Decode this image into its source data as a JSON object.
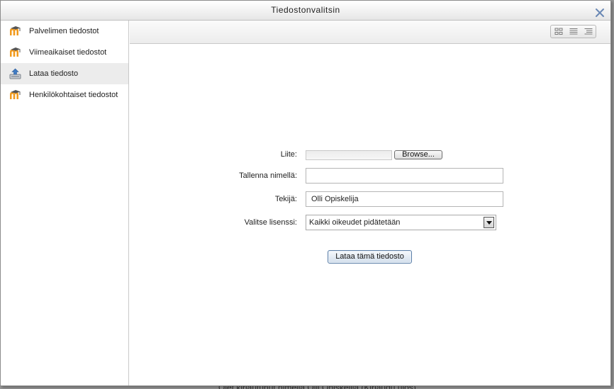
{
  "backdrop": {
    "text": "Olet kirjautunut nimellä Olli Opiskelija (Kirjaudu ulos)"
  },
  "dialog": {
    "title": "Tiedostonvalitsin",
    "close_icon": "close-icon"
  },
  "sidebar": {
    "items": [
      {
        "label": "Palvelimen tiedostot",
        "icon": "moodle-icon",
        "active": false
      },
      {
        "label": "Viimeaikaiset tiedostot",
        "icon": "moodle-icon",
        "active": false
      },
      {
        "label": "Lataa tiedosto",
        "icon": "upload-icon",
        "active": true
      },
      {
        "label": "Henkilökohtaiset tiedostot",
        "icon": "moodle-icon",
        "active": false
      }
    ]
  },
  "toolbar": {
    "view_buttons": [
      "icons-view-icon",
      "list-view-icon",
      "tree-view-icon"
    ]
  },
  "form": {
    "attachment_label": "Liite:",
    "browse_label": "Browse...",
    "save_as_label": "Tallenna nimellä:",
    "save_as_value": "",
    "author_label": "Tekijä:",
    "author_value": "Olli Opiskelija",
    "license_label": "Valitse lisenssi:",
    "license_value": "Kaikki oikeudet pidätetään",
    "upload_label": "Lataa tämä tiedosto"
  },
  "colors": {
    "moodle_orange": "#f29a1b",
    "moodle_dark": "#555555",
    "upload_button_border": "#5c7fa8",
    "close_blue": "#6a88b5"
  }
}
